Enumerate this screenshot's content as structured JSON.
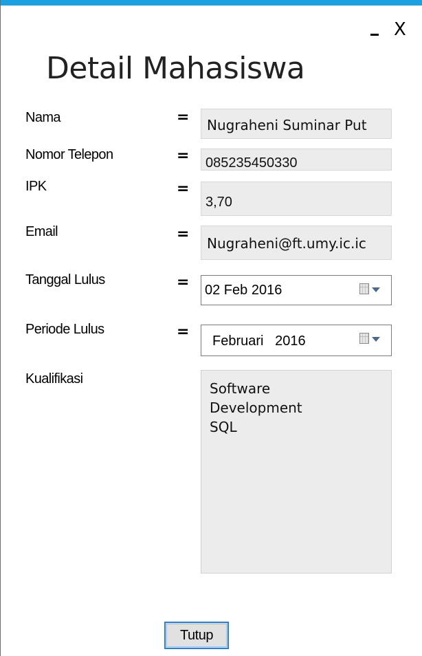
{
  "window": {
    "title": "Detail Mahasiswa",
    "minimize_label": "_",
    "close_label": "X"
  },
  "form": {
    "equals": "=",
    "nama": {
      "label": "Nama",
      "value": "Nugraheni Suminar Put"
    },
    "telepon": {
      "label": "Nomor Telepon",
      "value": "085235450330"
    },
    "ipk": {
      "label": "IPK",
      "value": "3,70"
    },
    "email": {
      "label": "Email",
      "value": "Nugraheni@ft.umy.ic.ic"
    },
    "tanggal_lulus": {
      "label": "Tanggal Lulus",
      "value": "02 Feb 2016"
    },
    "periode_lulus": {
      "label": "Periode Lulus",
      "value": "Februari   2016"
    },
    "kualifikasi": {
      "label": "Kualifikasi",
      "lines": [
        "Software",
        "Development",
        "SQL"
      ]
    }
  },
  "buttons": {
    "close_label": "Tutup"
  },
  "icons": {
    "calendar": "calendar-icon",
    "dropdown": "chevron-down-icon"
  },
  "colors": {
    "accent": "#1ba1e2",
    "field_bg": "#ececec",
    "button_border": "#2a80d6"
  }
}
